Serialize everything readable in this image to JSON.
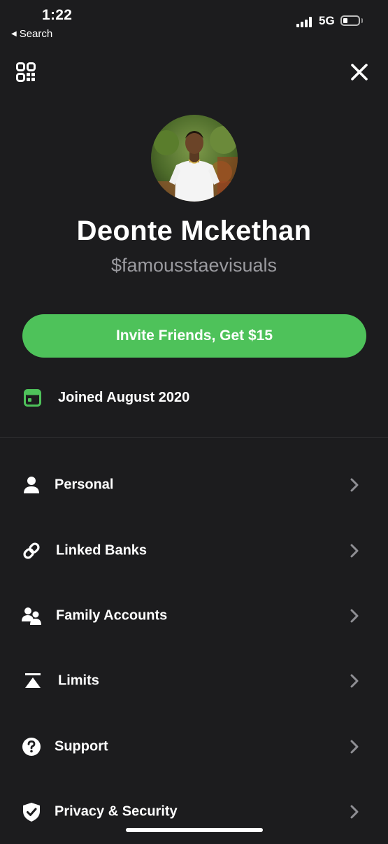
{
  "status_bar": {
    "time": "1:22",
    "back_label": "Search",
    "network": "5G",
    "battery_level": 0.2
  },
  "header": {
    "qr_icon": "qr-code-icon",
    "close_icon": "close-icon"
  },
  "profile": {
    "name": "Deonte Mckethan",
    "cashtag": "$famousstaevisuals",
    "avatar_icon": "profile-photo"
  },
  "invite_button": {
    "label": "Invite Friends, Get $15",
    "color": "#4ec25a"
  },
  "joined": {
    "icon": "calendar-icon",
    "label": "Joined August 2020"
  },
  "menu": {
    "items": [
      {
        "label": "Personal",
        "icon": "person-icon"
      },
      {
        "label": "Linked Banks",
        "icon": "link-icon"
      },
      {
        "label": "Family Accounts",
        "icon": "family-icon"
      },
      {
        "label": "Limits",
        "icon": "limits-icon"
      },
      {
        "label": "Support",
        "icon": "question-icon"
      },
      {
        "label": "Privacy & Security",
        "icon": "shield-icon"
      }
    ]
  },
  "colors": {
    "background": "#1c1c1e",
    "accent_green": "#4ec25a",
    "secondary_text": "#9a9a9f",
    "chevron": "#8e8e93"
  }
}
